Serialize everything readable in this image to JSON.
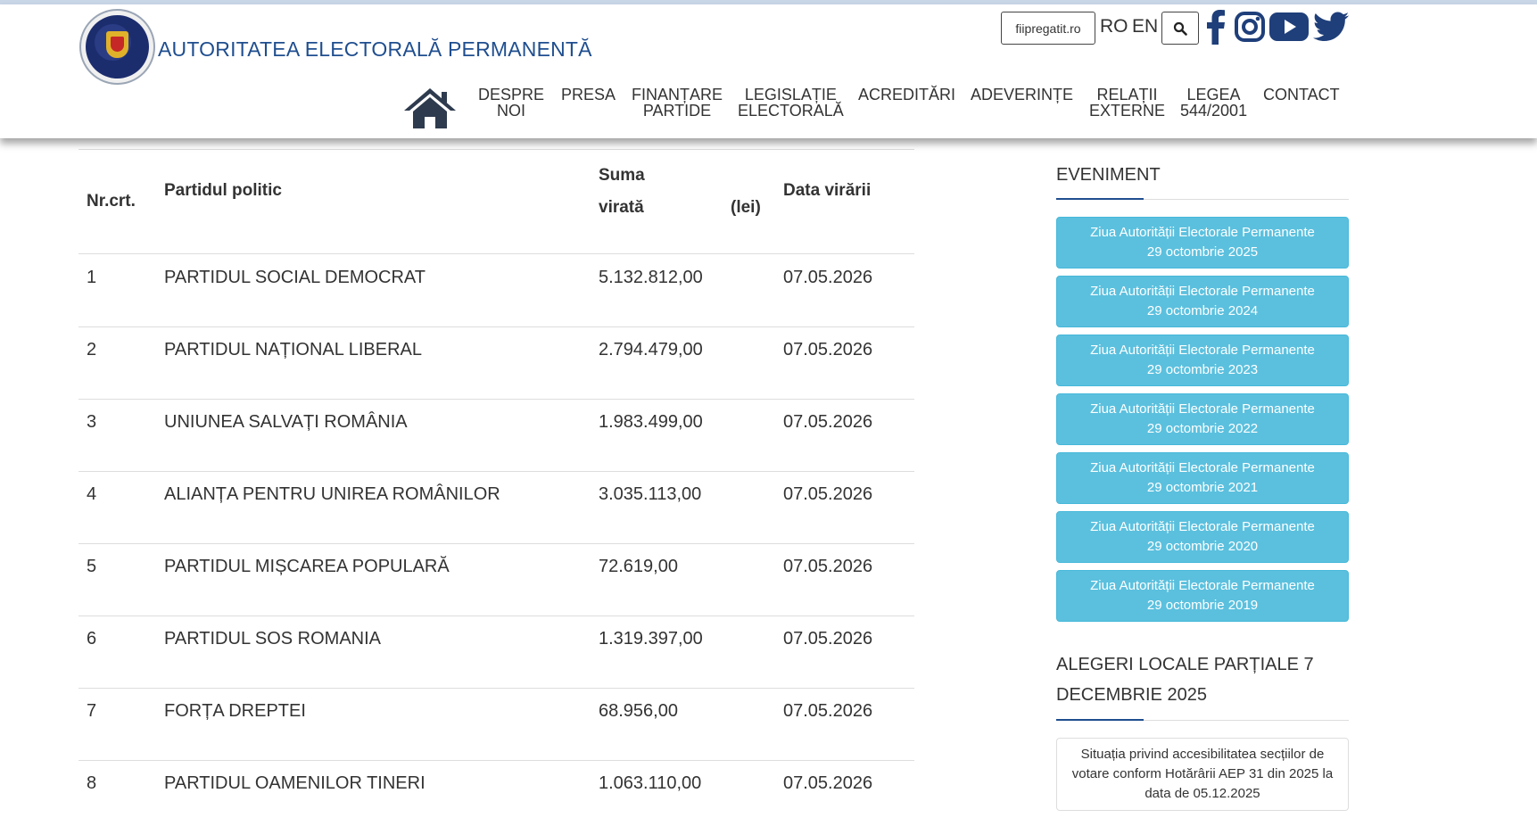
{
  "header": {
    "site_title": "AUTORITATEA ELECTORALĂ PERMANENTĂ",
    "pregatit_label": "fiipregatit.ro",
    "lang_ro": "RO",
    "lang_en": "EN",
    "icons": {
      "logo": "aep-seal-logo",
      "search": "search-icon",
      "facebook": "facebook-icon",
      "instagram": "instagram-icon",
      "youtube": "youtube-icon",
      "twitter": "twitter-icon",
      "home": "home-icon"
    }
  },
  "nav": {
    "items": [
      {
        "line1": "DESPRE",
        "line2": "NOI"
      },
      {
        "line1": "PRESA",
        "line2": ""
      },
      {
        "line1": "FINANȚARE",
        "line2": "PARTIDE"
      },
      {
        "line1": "LEGISLAȚIE",
        "line2": "ELECTORALĂ"
      },
      {
        "line1": "ACREDITĂRI",
        "line2": ""
      },
      {
        "line1": "ADEVERINȚE",
        "line2": ""
      },
      {
        "line1": "RELAȚII",
        "line2": "EXTERNE"
      },
      {
        "line1": "LEGEA",
        "line2": "544/2001"
      },
      {
        "line1": "CONTACT",
        "line2": ""
      }
    ]
  },
  "table": {
    "headers": {
      "nr": "Nr.crt.",
      "party": "Partidul politic",
      "sum_line1": "Suma",
      "sum_line2": "virată",
      "sum_unit": "(lei)",
      "date": "Data virării"
    },
    "rows": [
      {
        "nr": "1",
        "party": "PARTIDUL SOCIAL DEMOCRAT",
        "sum": "5.132.812,00",
        "date": "07.05.2026"
      },
      {
        "nr": "2",
        "party": "PARTIDUL NAȚIONAL LIBERAL",
        "sum": "2.794.479,00",
        "date": "07.05.2026"
      },
      {
        "nr": "3",
        "party": "UNIUNEA SALVAȚI ROMÂNIA",
        "sum": "1.983.499,00",
        "date": "07.05.2026"
      },
      {
        "nr": "4",
        "party": "ALIANȚA PENTRU UNIREA ROMÂNILOR",
        "sum": "3.035.113,00",
        "date": "07.05.2026"
      },
      {
        "nr": "5",
        "party": "PARTIDUL MIȘCAREA POPULARĂ",
        "sum": "72.619,00",
        "date": "07.05.2026"
      },
      {
        "nr": "6",
        "party": "PARTIDUL SOS ROMANIA",
        "sum": "1.319.397,00",
        "date": "07.05.2026"
      },
      {
        "nr": "7",
        "party": "FORȚA DREPTEI",
        "sum": "68.956,00",
        "date": "07.05.2026"
      },
      {
        "nr": "8",
        "party": "PARTIDUL OAMENILOR TINERI",
        "sum": "1.063.110,00",
        "date": "07.05.2026"
      }
    ]
  },
  "sidebar": {
    "event_heading": "EVENIMENT",
    "events": [
      {
        "line1": "Ziua Autorității Electorale Permanente",
        "line2": "29 octombrie 2025"
      },
      {
        "line1": "Ziua Autorității Electorale Permanente",
        "line2": "29 octombrie 2024"
      },
      {
        "line1": "Ziua Autorității Electorale Permanente",
        "line2": "29 octombrie 2023"
      },
      {
        "line1": "Ziua Autorității Electorale Permanente",
        "line2": "29 octombrie 2022"
      },
      {
        "line1": "Ziua Autorității Electorale Permanente",
        "line2": "29 octombrie 2021"
      },
      {
        "line1": "Ziua Autorității Electorale Permanente",
        "line2": "29 octombrie 2020"
      },
      {
        "line1": "Ziua Autorității Electorale Permanente",
        "line2": "29 octombrie 2019"
      }
    ],
    "elections_heading_line1": "ALEGERI LOCALE PARȚIALE 7",
    "elections_heading_line2": "DECEMBRIE 2025",
    "info_text": "Situația privind accesibilitatea secțiilor de votare conform Hotărârii AEP 31 din 2025 la data de 05.12.2025"
  },
  "colors": {
    "title_blue": "#1f4e8f",
    "event_button": "#5bc0de",
    "text": "#333333",
    "divider": "#dddddd"
  }
}
